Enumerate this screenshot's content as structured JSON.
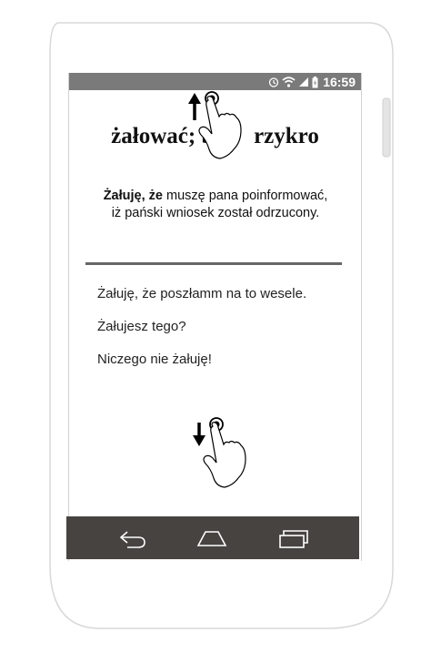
{
  "status": {
    "time": "16:59"
  },
  "headword": {
    "text": "żałować; by     rzykro"
  },
  "example": {
    "bold": "Żałuję, że",
    "rest": " muszę pana poinformować, iż pański wniosek został odrzucony."
  },
  "examples": [
    "Żałuję, że poszłamm na to wesele.",
    "Żałujesz tego?",
    "Niczego nie żałuję!"
  ],
  "icons": {
    "alarm": "alarm-icon",
    "wifi": "wifi-icon",
    "signal": "signal-icon",
    "battery": "battery-charging-icon",
    "back": "back-icon",
    "home": "home-icon",
    "recents": "recents-icon",
    "swipe_up": "swipe-up-gesture-icon",
    "swipe_down": "swipe-down-gesture-icon"
  },
  "colors": {
    "statusbar": "#7a7a7a",
    "navbar": "#464340",
    "divider": "#666666"
  }
}
